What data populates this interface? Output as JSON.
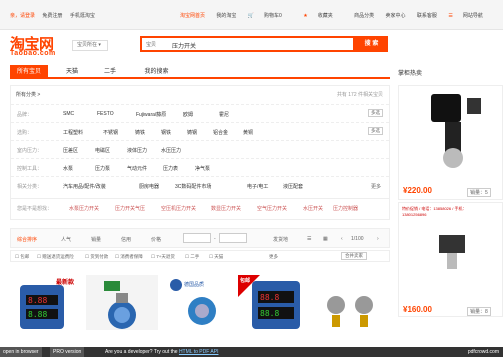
{
  "topbar": {
    "left": [
      "亲，请登录",
      "免费注册",
      "手机逛淘宝"
    ],
    "right": [
      "淘宝网首页",
      "我的淘宝",
      "购物车0",
      "收藏夹",
      "商品分类",
      "卖家中心",
      "联系客服",
      "网站导航"
    ]
  },
  "header": {
    "logo": "淘宝网",
    "logo_sub": "Taobao.com",
    "region": "宝贝所在",
    "search_category": "宝贝",
    "search_query": "压力开关",
    "search_button": "搜 索"
  },
  "tabs": [
    "所有宝贝",
    "天猫",
    "二手",
    "我的搜索"
  ],
  "hot_title": "掌柜热卖",
  "filter": {
    "header_left": "所有分类 >",
    "header_right": "共有 172 件相关宝贝",
    "rows": [
      {
        "label": "品牌：",
        "values": [
          "SMC",
          "FESTO",
          "Fujiwara/藤原",
          "欧姆",
          "霍尼"
        ],
        "more": "多选"
      },
      {
        "label": "选购：",
        "values": [
          "工程塑料",
          "不锈钢",
          "铸铁",
          "钢铁",
          "铸钢",
          "铝合金",
          "黄铜"
        ],
        "more": "多选"
      },
      {
        "label": "室内压力：",
        "values": [
          "压差区",
          "电磁区",
          "液体压力",
          "水压压力"
        ],
        "more": ""
      },
      {
        "label": "控制工具：",
        "values": [
          "水泵",
          "压力泵",
          "气动元件",
          "压力表",
          "净气泵"
        ],
        "more": ""
      },
      {
        "label": "相关分类：",
        "values": [
          "汽车用品/配件/改装",
          "厨房电器",
          "3C数码配件市场",
          "电子/电工",
          "液压配套"
        ],
        "more": "更多"
      },
      {
        "label": "您是不是想找：",
        "values": [
          "水泵压力开关",
          "压力开关气压",
          "空压机压力开关",
          "数显压力开关",
          "空气压力开关",
          "水压开关",
          "压力控制器"
        ],
        "more": ""
      }
    ]
  },
  "sortbar": {
    "items": [
      "综合排序",
      "人气",
      "销量",
      "信用",
      "价格"
    ],
    "right": "发货地",
    "page": "1/100"
  },
  "checkrow": [
    "包邮",
    "赠送退货运费险",
    "货到付款",
    "消费者保障",
    "7+天退货",
    "二手",
    "天猫",
    "更多",
    "合并卖家"
  ],
  "products": [
    {
      "label": "最新款"
    },
    {
      "label": ""
    },
    {
      "label": "德国品质"
    },
    {
      "label": "包邮"
    },
    {
      "label": ""
    }
  ],
  "hot": [
    {
      "price": "¥220.00",
      "sales": "销量：5"
    },
    {
      "price": "¥160.00",
      "sales": "销量：8",
      "promo": "特价促销 / 电话：13858026 / 手机：13801256896"
    }
  ],
  "banner": {
    "btn1": "open in browser",
    "btn2": "PRO version",
    "text": "Are you a developer? Try out the ",
    "link": "HTML to PDF API",
    "right": "pdfcrowd.com"
  },
  "colors": {
    "accent": "#ff4400"
  }
}
